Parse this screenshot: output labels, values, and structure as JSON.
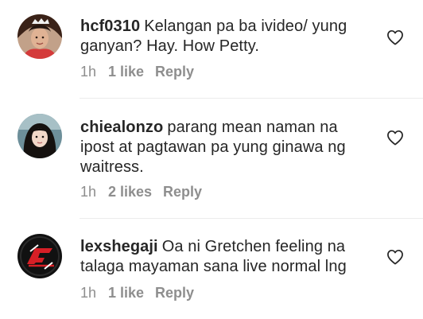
{
  "comments": [
    {
      "username": "hcf0310",
      "text": "Kelangan pa ba ivideo/ yung ganyan? Hay. How Petty.",
      "time": "1h",
      "likes": "1 like",
      "reply": "Reply"
    },
    {
      "username": "chiealonzo",
      "text": "parang mean naman na ipost at pagtawan pa yung ginawa ng waitress.",
      "time": "1h",
      "likes": "2 likes",
      "reply": "Reply"
    },
    {
      "username": "lexshegaji",
      "text": "Oa ni  Gretchen feeling na talaga mayaman sana live normal lng",
      "time": "1h",
      "likes": "1 like",
      "reply": "Reply"
    }
  ],
  "icons": {
    "like": "heart-outline-icon"
  },
  "colors": {
    "text": "#262626",
    "meta": "#8e8e8e",
    "divider": "#ececec"
  }
}
